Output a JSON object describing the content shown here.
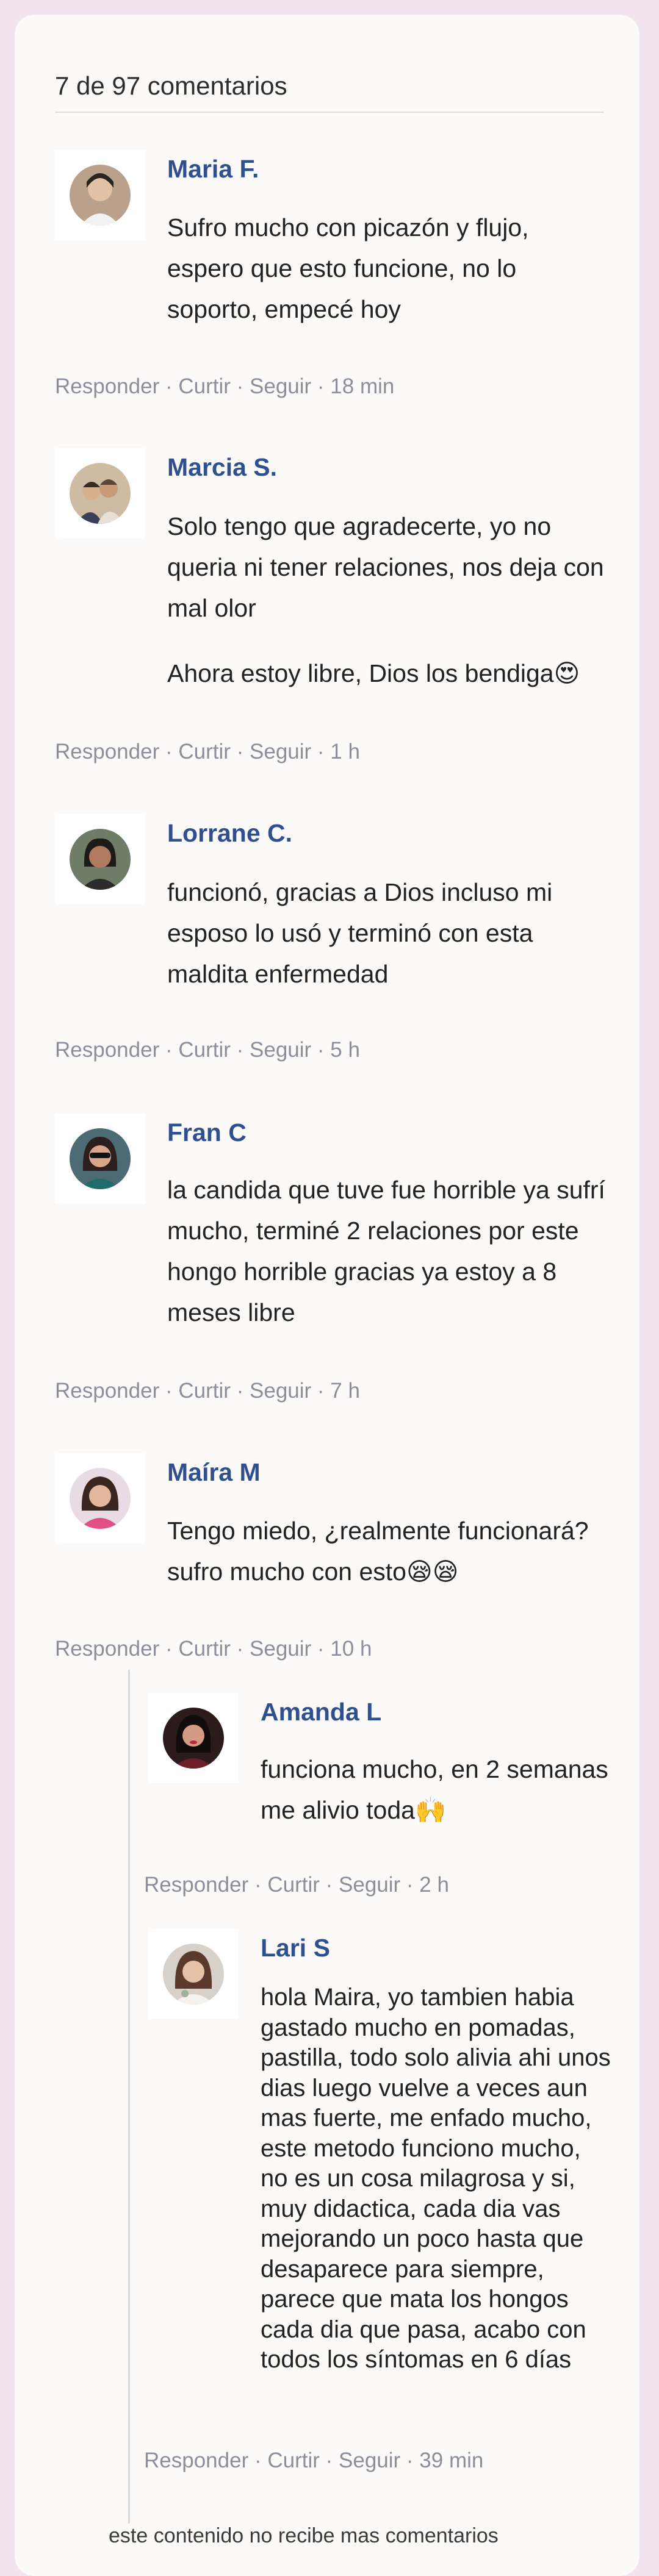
{
  "header": {
    "count_label": "7 de 97 comentarios"
  },
  "action_labels": {
    "reply": "Responder",
    "like": "Curtir",
    "follow": "Seguir",
    "separator": " · "
  },
  "comments": [
    {
      "author": "Maria F.",
      "paragraphs": [
        "Sufro mucho con picazón y flujo, espero que esto funcione, no lo soporto, empecé hoy"
      ],
      "time": "18 min"
    },
    {
      "author": "Marcia S.",
      "paragraphs": [
        "Solo tengo que agradecerte, yo no queria ni tener relaciones, nos deja con mal olor",
        "Ahora estoy libre, Dios los bendiga😍"
      ],
      "time": "1 h"
    },
    {
      "author": "Lorrane C.",
      "paragraphs": [
        "funcionó, gracias a Dios incluso mi esposo lo usó y terminó con esta maldita enfermedad"
      ],
      "time": "5 h"
    },
    {
      "author": "Fran C",
      "paragraphs": [
        "la candida que tuve fue horrible ya sufrí mucho, terminé 2 relaciones por este hongo horrible   gracias  ya estoy a 8 meses libre"
      ],
      "time": "7 h"
    },
    {
      "author": "Maíra M",
      "paragraphs": [
        "Tengo miedo, ¿realmente funcionará? sufro mucho con esto😪😪"
      ],
      "time": "10 h"
    }
  ],
  "replies": [
    {
      "author": "Amanda L",
      "paragraphs": [
        " funciona mucho, en 2 semanas me alivio toda🙌"
      ],
      "time": "2 h"
    },
    {
      "author": "Lari S",
      "paragraphs": [
        "hola Maira, yo tambien habia gastado mucho  en pomadas, pastilla, todo solo alivia ahi unos dias luego vuelve a veces aun mas fuerte, me enfado mucho, este metodo funciono mucho, no es un cosa milagrosa y si, muy didactica, cada dia vas mejorando un poco hasta que desaparece para siempre, parece que mata los hongos cada dia que pasa, acabo con todos los síntomas en 6 días"
      ],
      "time": "39 min"
    }
  ],
  "footer": {
    "closed_note": "este contenido no recibe mas comentarios"
  }
}
